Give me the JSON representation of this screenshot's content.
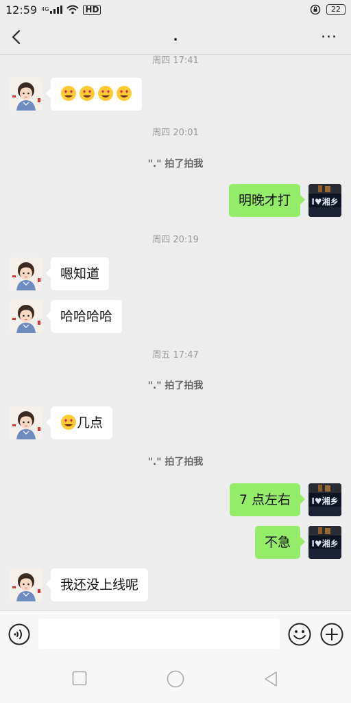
{
  "status_bar": {
    "time": "12:59",
    "network": "4G",
    "hd": "HD",
    "battery": "22"
  },
  "nav": {
    "title": ".",
    "more": "···"
  },
  "messages": [
    {
      "type": "timestamp",
      "text": "周四 17:41"
    },
    {
      "type": "incoming",
      "emoji_count": 4,
      "text": ""
    },
    {
      "type": "timestamp",
      "text": "周四 20:01"
    },
    {
      "type": "system",
      "text": "\".\" 拍了拍我"
    },
    {
      "type": "outgoing",
      "text": "明晚才打"
    },
    {
      "type": "timestamp",
      "text": "周四 20:19"
    },
    {
      "type": "incoming",
      "text": "嗯知道"
    },
    {
      "type": "incoming",
      "text": "哈哈哈哈"
    },
    {
      "type": "timestamp",
      "text": "周五 17:47"
    },
    {
      "type": "system",
      "text": "\".\" 拍了拍我"
    },
    {
      "type": "incoming",
      "emoji_count": 1,
      "text": "几点"
    },
    {
      "type": "system",
      "text": "\".\" 拍了拍我"
    },
    {
      "type": "outgoing",
      "text": "7 点左右"
    },
    {
      "type": "outgoing",
      "text": "不急"
    },
    {
      "type": "incoming",
      "text": "我还没上线呢"
    }
  ],
  "my_avatar_text": "I♥湘乡",
  "input": {
    "value": "",
    "placeholder": ""
  },
  "icons": {
    "back": "back-chevron-icon",
    "more": "more-dots-icon",
    "voice": "voice-icon",
    "emoji": "smiley-icon",
    "plus": "plus-icon",
    "sys_recent": "square-icon",
    "sys_home": "circle-icon",
    "sys_back": "triangle-back-icon"
  },
  "colors": {
    "background": "#ededed",
    "outgoing_bubble": "#95ec69",
    "incoming_bubble": "#ffffff"
  }
}
